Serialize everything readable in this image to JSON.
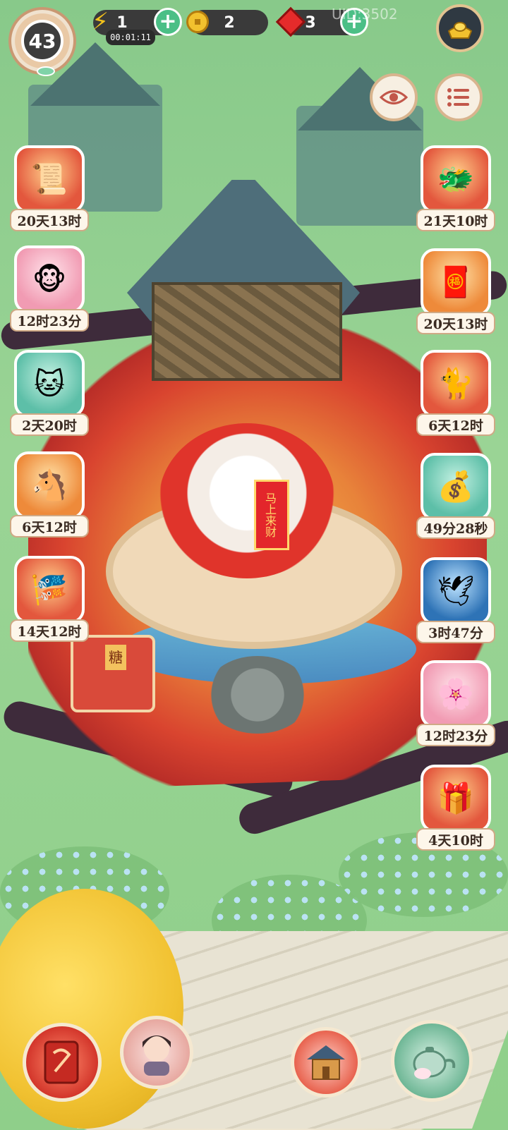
{
  "hud": {
    "level": "43",
    "energy": {
      "value": "1",
      "timer": "00:01:11"
    },
    "coins": {
      "value": "2"
    },
    "gems": {
      "value": "3"
    },
    "uid": "UID:3502"
  },
  "scene": {
    "scroll_text": "马上来财",
    "stall_sign": "糖"
  },
  "events_left": [
    {
      "id": "book-bundle",
      "label": "20天13时",
      "icon": "📜"
    },
    {
      "id": "monkey",
      "label": "12时23分",
      "icon": "🐵"
    },
    {
      "id": "lucky-cat",
      "label": "2天20时",
      "icon": "🐱"
    },
    {
      "id": "golden-horse",
      "label": "6天12时",
      "icon": "🐴"
    },
    {
      "id": "red-fan",
      "label": "14天12时",
      "icon": "🎏"
    }
  ],
  "events_right": [
    {
      "id": "dragon-pup",
      "label": "21天10时",
      "icon": "🐲"
    },
    {
      "id": "mystery-envelope",
      "label": "20天13时",
      "icon": "🧧"
    },
    {
      "id": "cat-with-fan",
      "label": "6天12时",
      "icon": "🐈"
    },
    {
      "id": "treasure-cart",
      "label": "49分28秒",
      "icon": "💰"
    },
    {
      "id": "golden-crane",
      "label": "3时47分",
      "icon": "🕊"
    },
    {
      "id": "blossom-cat",
      "label": "12时23分",
      "icon": "🌸"
    },
    {
      "id": "treasure-chest",
      "label": "4天10时",
      "icon": "🎁"
    }
  ],
  "colors": {
    "plus_green": "#4bbf86",
    "label_bg": "#fdf6ea",
    "hud_dark": "#3a3a3a"
  }
}
